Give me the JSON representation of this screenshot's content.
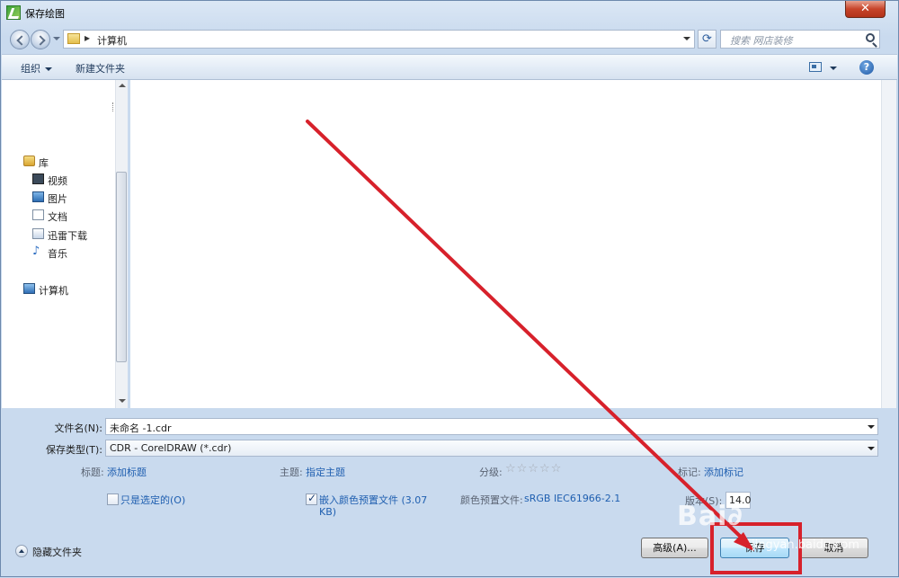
{
  "window": {
    "title": "保存绘图",
    "close_label": "✕"
  },
  "address": {
    "location": "计算机",
    "chevron": "▸",
    "search_placeholder": "搜索 网店装修",
    "refresh_symbol": "⟳"
  },
  "toolbar": {
    "organize": "组织",
    "new_folder": "新建文件夹",
    "help": "?"
  },
  "nav": {
    "items": [
      {
        "label": "库"
      },
      {
        "label": "视频"
      },
      {
        "label": "图片"
      },
      {
        "label": "文档"
      },
      {
        "label": "迅雷下载"
      },
      {
        "label": "音乐"
      },
      {
        "label": "计算机"
      }
    ]
  },
  "form": {
    "filename_label": "文件名(N):",
    "filename_value": "未命名 -1.cdr",
    "filetype_label": "保存类型(T):",
    "filetype_value": "CDR - CorelDRAW (*.cdr)"
  },
  "meta": {
    "title_label": "标题:",
    "title_value": "添加标题",
    "subject_label": "主题:",
    "subject_value": "指定主题",
    "rating_label": "分级:",
    "rating_stars": "☆☆☆☆☆",
    "tags_label": "标记:",
    "tags_value": "添加标记"
  },
  "options": {
    "selected_only": {
      "label": "只是选定的(O)",
      "checked": false
    },
    "embed_profile": {
      "label_line1": "嵌入颜色预置文件 (3.07",
      "label_line2": "KB)",
      "checked": true
    },
    "color_profile_label": "颜色预置文件:",
    "color_profile_value": "sRGB IEC61966-2.1",
    "version_label": "版本(S):",
    "version_value": "14.0"
  },
  "footer": {
    "hide_folders": "隐藏文件夹",
    "advanced_button": "高级(A)...",
    "save_button": "保存",
    "cancel_button": "取消"
  },
  "watermark": {
    "text": "Bai∂",
    "sub": "jingyan.baidu.com"
  },
  "colors": {
    "annotation": "#d7212b",
    "link": "#1f5fb0"
  }
}
